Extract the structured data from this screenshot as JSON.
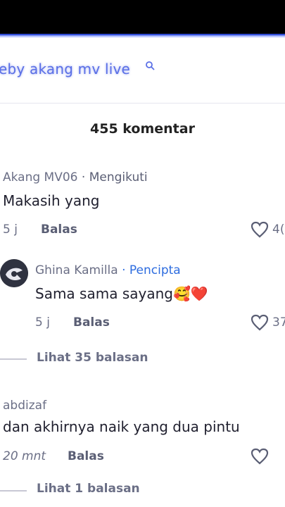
{
  "search": {
    "query": "eby akang mv live"
  },
  "comments_header": {
    "title": "455 komentar"
  },
  "comment1": {
    "username": "Akang MV06",
    "follow_status": " · Mengikuti",
    "text": "Makasih yang",
    "time": "5 j",
    "reply_label": "Balas",
    "likes": "4("
  },
  "reply1": {
    "username": "Ghina Kamilla",
    "tag": " · Pencipta",
    "text": "Sama sama sayang🥰❤️",
    "time": "5 j",
    "reply_label": "Balas",
    "likes": "37",
    "view_replies": "Lihat 35 balasan"
  },
  "comment2": {
    "username": "abdizaf",
    "text": "dan akhirnya naik yang dua pintu",
    "time": "20 mnt",
    "reply_label": "Balas",
    "view_replies": "Lihat 1 balasan"
  },
  "colors": {
    "accent": "#2d6cdf",
    "search_text": "#5a6fe6",
    "topbar": "#000000"
  }
}
